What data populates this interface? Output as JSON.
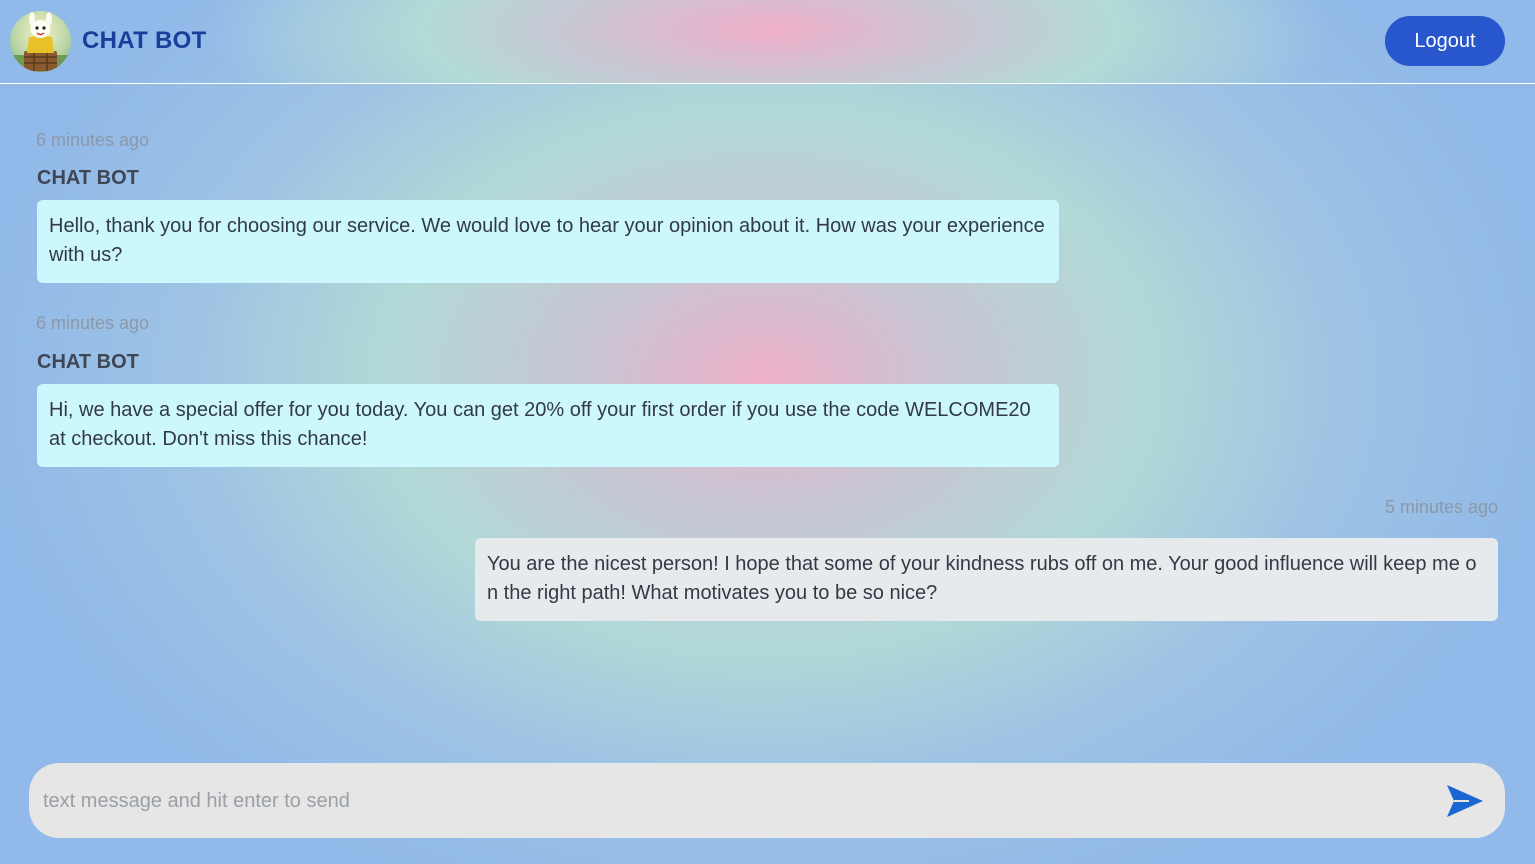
{
  "header": {
    "title": "CHAT BOT",
    "logout_label": "Logout",
    "avatar_icon": "cartoon-avatar-icon"
  },
  "messages": [
    {
      "time": "6 minutes ago",
      "sender": "CHAT BOT",
      "text": "Hello, thank you for choosing our service. We would love to hear your opinion about it. How was your experience with us?"
    },
    {
      "time": "6 minutes ago",
      "sender": "CHAT BOT",
      "text": "Hi, we have a special offer for you today. You can get 20% off your first order if you use the code WELCOME20 at checkout. Don't miss this chance!"
    },
    {
      "time": "5 minutes ago",
      "sender": "",
      "text": "You are the nicest person! I hope that some of your kindness rubs off on me. Your good influence will keep me on the right path! What motivates you to be so nice?"
    }
  ],
  "composer": {
    "placeholder": "text message and hit enter to send",
    "value": "",
    "send_icon": "send-arrow-icon"
  },
  "colors": {
    "accent": "#2856cc",
    "title": "#1a3f9b",
    "bot_bubble": "#ccf7fc",
    "user_bubble": "#e6eaed",
    "send_icon": "#1a66d2"
  }
}
